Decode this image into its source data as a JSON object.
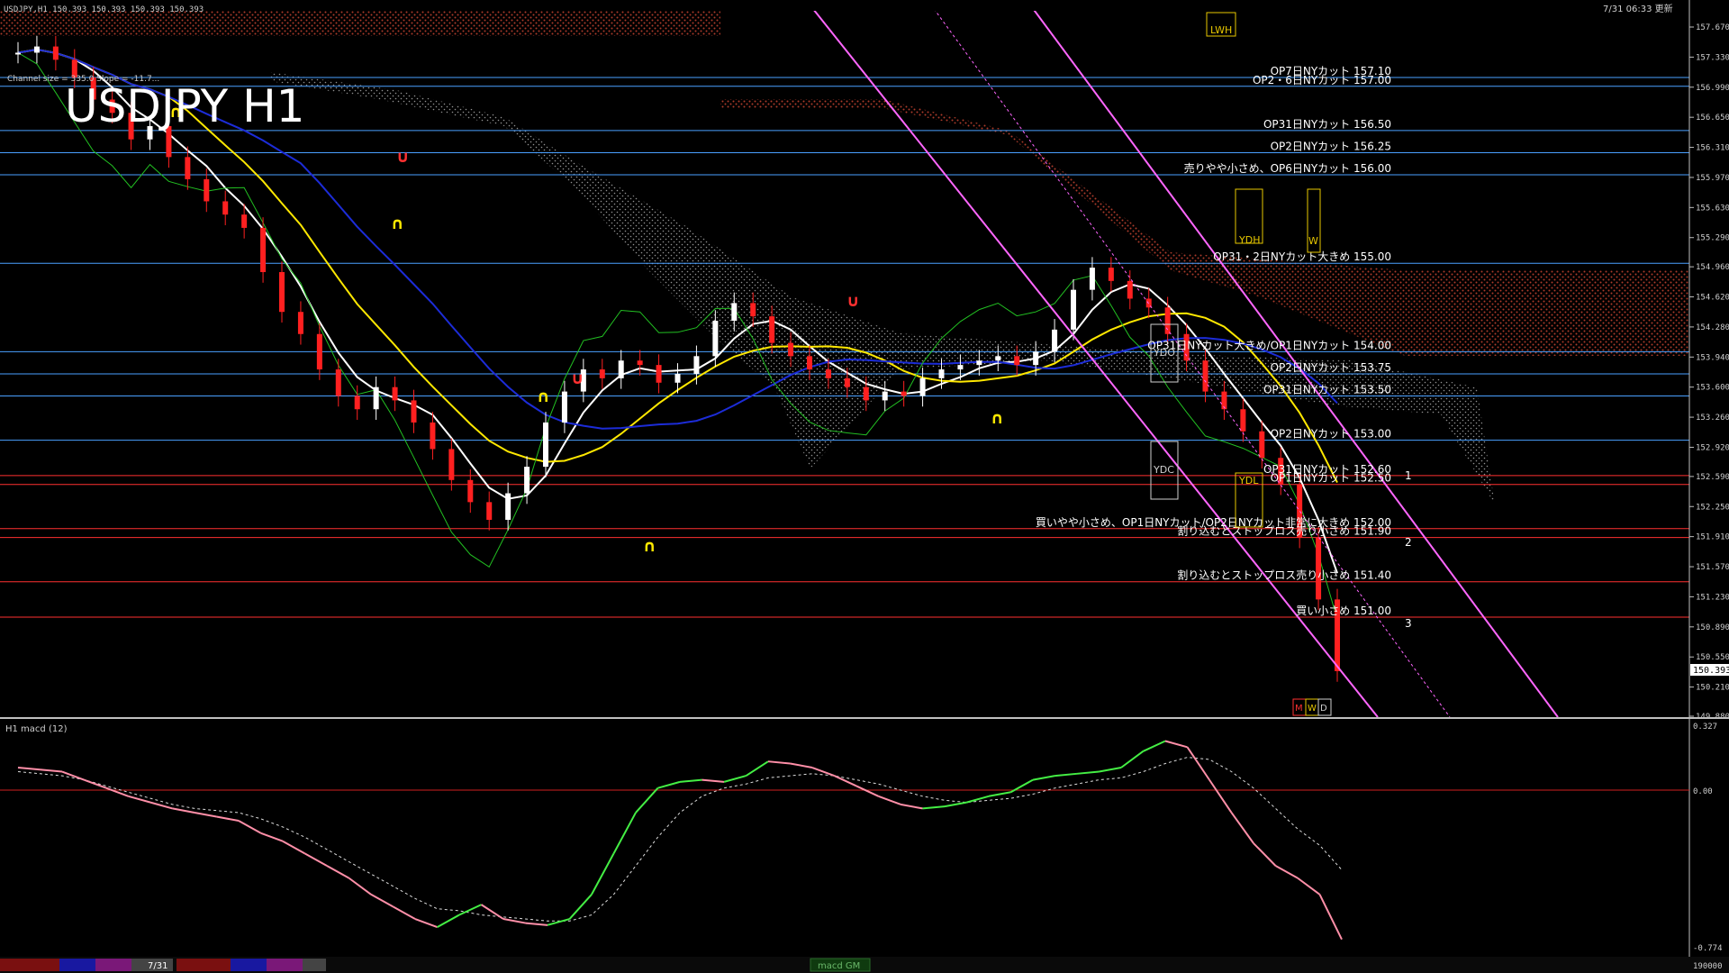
{
  "window": {
    "header_left": "USDJPY,H1  150.393 150.393 150.393 150.393",
    "header_right": "7/31 06:33 更新",
    "watermark": "USDJPY H1",
    "channel_info": "Channel size = 335.0 Slope = -11.7..."
  },
  "price_axis": {
    "ticks": [
      "157.670",
      "157.330",
      "156.990",
      "156.650",
      "156.310",
      "155.970",
      "155.630",
      "155.290",
      "154.960",
      "154.620",
      "154.280",
      "153.940",
      "153.600",
      "153.260",
      "152.920",
      "152.590",
      "152.250",
      "151.910",
      "151.570",
      "151.230",
      "150.890",
      "150.550",
      "150.210",
      "149.880"
    ],
    "current_price": "150.393"
  },
  "levels": [
    {
      "label": "OP7日NYカット 157.10",
      "color": "#4aa0ff"
    },
    {
      "label": "OP2・6日NYカット 157.00",
      "color": "#4aa0ff"
    },
    {
      "label": "OP31日NYカット 156.50",
      "color": "#4aa0ff"
    },
    {
      "label": "OP2日NYカット 156.25",
      "color": "#4aa0ff"
    },
    {
      "label": "売りやや小さめ、OP6日NYカット 156.00",
      "color": "#4aa0ff"
    },
    {
      "label": "OP31・2日NYカット大きめ 155.00",
      "color": "#4aa0ff"
    },
    {
      "label": "OP31日NYカット大きめ/OP1日NYカット 154.00",
      "color": "#4aa0ff"
    },
    {
      "label": "OP2日NYカット 153.75",
      "color": "#4aa0ff"
    },
    {
      "label": "OP31日NYカット 153.50",
      "color": "#4aa0ff"
    },
    {
      "label": "OP2日NYカット 153.00",
      "color": "#4aa0ff"
    },
    {
      "label": "OP31日NYカット 152.60",
      "color": "#ff3030"
    },
    {
      "label": "OP1日NYカット 152.50",
      "color": "#ff3030"
    },
    {
      "label": "買いやや小さめ、OP1日NYカット/OP2日NYカット非常に大きめ 152.00",
      "color": "#ff3030"
    },
    {
      "label": "割り込むとストップロス売り小さめ 151.90",
      "color": "#ff3030"
    },
    {
      "label": "割り込むとストップロス売り小さめ 151.40",
      "color": "#ff3030"
    },
    {
      "label": "買い小さめ 151.00",
      "color": "#ff3030"
    }
  ],
  "chart_markers": {
    "ydh": "YDH",
    "ydl": "YDL",
    "ydo": "YDO",
    "ydc": "YDC",
    "lwh": "LWH",
    "w": "W",
    "m": "M",
    "d": "D",
    "fib_1": "1",
    "fib_2": "2",
    "fib_3": "3"
  },
  "macd_panel": {
    "title": "H1  macd (12)",
    "ticks": [
      "0.327",
      "0.00",
      "-0.774"
    ]
  },
  "bottom_bar": {
    "date_label": "7/31",
    "tab_label": "macd GM",
    "axis_value": "190000"
  },
  "chart_data": {
    "type": "line",
    "symbol": "USDJPY",
    "timeframe": "H1",
    "ylim": [
      149.88,
      157.67
    ],
    "close": [
      157.38,
      157.45,
      157.3,
      157.1,
      156.85,
      156.7,
      156.4,
      156.55,
      156.2,
      155.95,
      155.7,
      155.55,
      155.4,
      154.9,
      154.45,
      154.2,
      153.8,
      153.5,
      153.35,
      153.6,
      153.45,
      153.2,
      152.9,
      152.55,
      152.3,
      152.1,
      152.4,
      152.7,
      153.2,
      153.55,
      153.8,
      153.7,
      153.9,
      153.85,
      153.65,
      153.75,
      153.95,
      154.35,
      154.55,
      154.4,
      154.1,
      153.95,
      153.8,
      153.7,
      153.6,
      153.45,
      153.55,
      153.5,
      153.7,
      153.8,
      153.85,
      153.9,
      153.95,
      153.85,
      154.0,
      154.25,
      154.7,
      154.95,
      154.8,
      154.6,
      154.5,
      154.2,
      153.9,
      153.55,
      153.35,
      153.1,
      152.8,
      152.5,
      151.9,
      151.2,
      150.39
    ],
    "macd": {
      "ylim": [
        -0.774,
        0.327
      ],
      "main": [
        0.12,
        0.11,
        0.1,
        0.06,
        0.02,
        -0.02,
        -0.05,
        -0.08,
        -0.1,
        -0.12,
        -0.14,
        -0.2,
        -0.24,
        -0.3,
        -0.36,
        -0.42,
        -0.5,
        -0.56,
        -0.62,
        -0.66,
        -0.6,
        -0.55,
        -0.62,
        -0.64,
        -0.65,
        -0.62,
        -0.5,
        -0.3,
        -0.1,
        0.02,
        0.05,
        0.06,
        0.05,
        0.08,
        0.15,
        0.14,
        0.12,
        0.08,
        0.03,
        -0.02,
        -0.06,
        -0.08,
        -0.07,
        -0.05,
        -0.02,
        0.0,
        0.06,
        0.08,
        0.09,
        0.1,
        0.12,
        0.2,
        0.25,
        0.22,
        0.06,
        -0.1,
        -0.25,
        -0.36,
        -0.42,
        -0.5,
        -0.72
      ],
      "signal": [
        0.1,
        0.09,
        0.08,
        0.06,
        0.03,
        0.0,
        -0.03,
        -0.06,
        -0.08,
        -0.09,
        -0.1,
        -0.13,
        -0.17,
        -0.22,
        -0.28,
        -0.34,
        -0.4,
        -0.46,
        -0.52,
        -0.57,
        -0.58,
        -0.6,
        -0.61,
        -0.62,
        -0.63,
        -0.63,
        -0.6,
        -0.5,
        -0.36,
        -0.22,
        -0.1,
        -0.02,
        0.02,
        0.04,
        0.07,
        0.08,
        0.09,
        0.08,
        0.06,
        0.04,
        0.01,
        -0.02,
        -0.04,
        -0.05,
        -0.04,
        -0.03,
        -0.01,
        0.02,
        0.04,
        0.06,
        0.07,
        0.1,
        0.14,
        0.17,
        0.16,
        0.1,
        0.02,
        -0.08,
        -0.18,
        -0.26,
        -0.38
      ]
    }
  },
  "colors": {
    "buy_level": "#4aa0ff",
    "sell_level": "#ff3030",
    "ichimoku_cloud": "#c83c28",
    "ma_white": "#ffffff",
    "ma_yellow": "#ffe800",
    "ma_blue": "#1c2cd8",
    "ichimoku_green": "#22c022",
    "macd_up": "#44ee44",
    "macd_down": "#ff8fa8",
    "channel": "#ff66ff"
  }
}
